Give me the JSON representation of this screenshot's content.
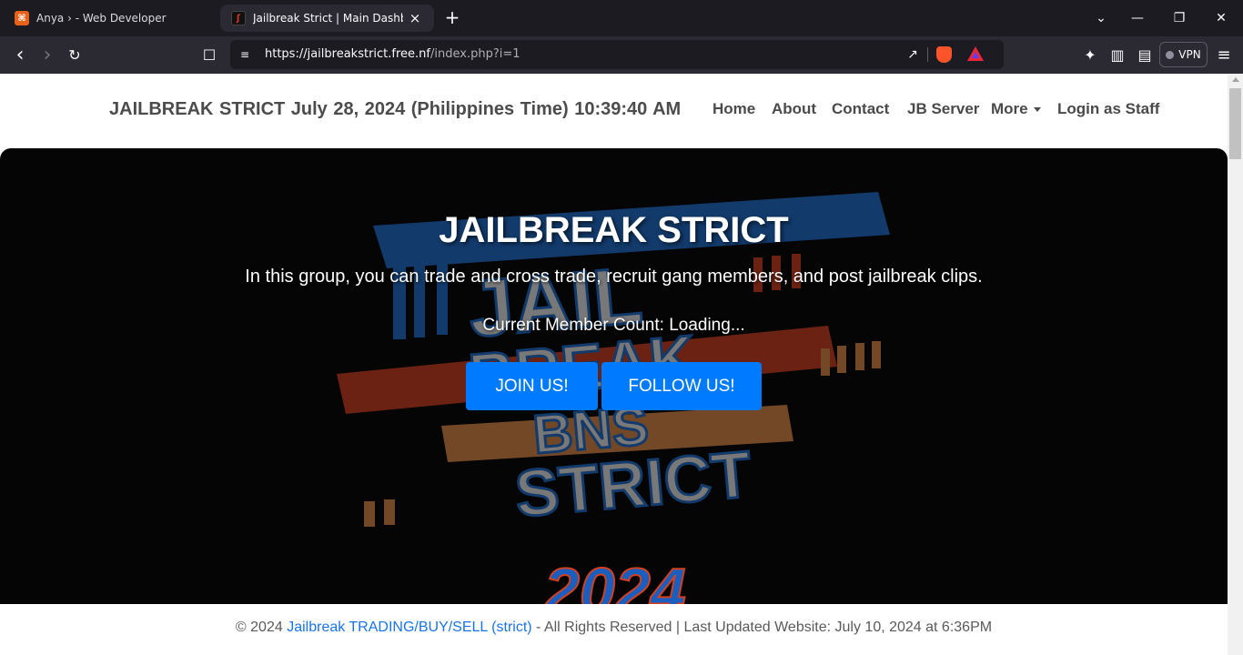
{
  "browser": {
    "tabs": [
      {
        "title": "Anya › - Web Developer",
        "favicon": "xampp-icon",
        "active": false
      },
      {
        "title": "Jailbreak Strict | Main Dashboard",
        "favicon": "jailbreak-favicon",
        "active": true
      }
    ],
    "url": {
      "host": "https://jailbreakstrict.free.nf",
      "path": "/index.php?i=1"
    },
    "vpn_label": "VPN",
    "icons": {
      "back": "‹",
      "forward": "›",
      "reload": "↻",
      "bookmark": "☐",
      "site_info": "≡",
      "share": "↗",
      "extensions": "✦",
      "sidebar": "▥",
      "wallet": "▤",
      "menu": "≡",
      "new_tab": "+",
      "tab_close": "×",
      "tab_list": "⌄",
      "minimize": "—",
      "restore": "❐",
      "close": "✕",
      "xampp_glyph": "⌘",
      "jailbreak_glyph": "ʃ"
    }
  },
  "navbar": {
    "brand": "JAILBREAK STRICT  July 28, 2024 (Philippines Time)  10:39:40 AM",
    "links": {
      "home": "Home",
      "about": "About",
      "contact": "Contact",
      "jb_server": "JB Server",
      "more": "More",
      "login": "Login as Staff"
    }
  },
  "hero": {
    "title": "JAILBREAK STRICT",
    "description": "In this group, you can trade and cross trade, recruit gang members, and post jailbreak clips.",
    "member_count": "Current Member Count: Loading...",
    "join_button": "JOIN US!",
    "follow_button": "FOLLOW US!",
    "background_art": {
      "words": [
        "JAIL",
        "BREAK",
        "BNS",
        "STRICT",
        "2024"
      ],
      "colors": {
        "blue": "#1f6fd1",
        "red": "#d2401f",
        "orange": "#e08a48",
        "white": "#eaeaea"
      }
    }
  },
  "footer": {
    "prefix": "© 2024 ",
    "link": "Jailbreak TRADING/BUY/SELL (strict)",
    "suffix": " - All Rights Reserved | Last Updated Website: July 10, 2024 at 6:36PM"
  },
  "colors": {
    "accent": "#007bff",
    "hero_bg": "#050505",
    "nav_text": "#4a4a4a",
    "footer_link": "#1a73e8"
  }
}
